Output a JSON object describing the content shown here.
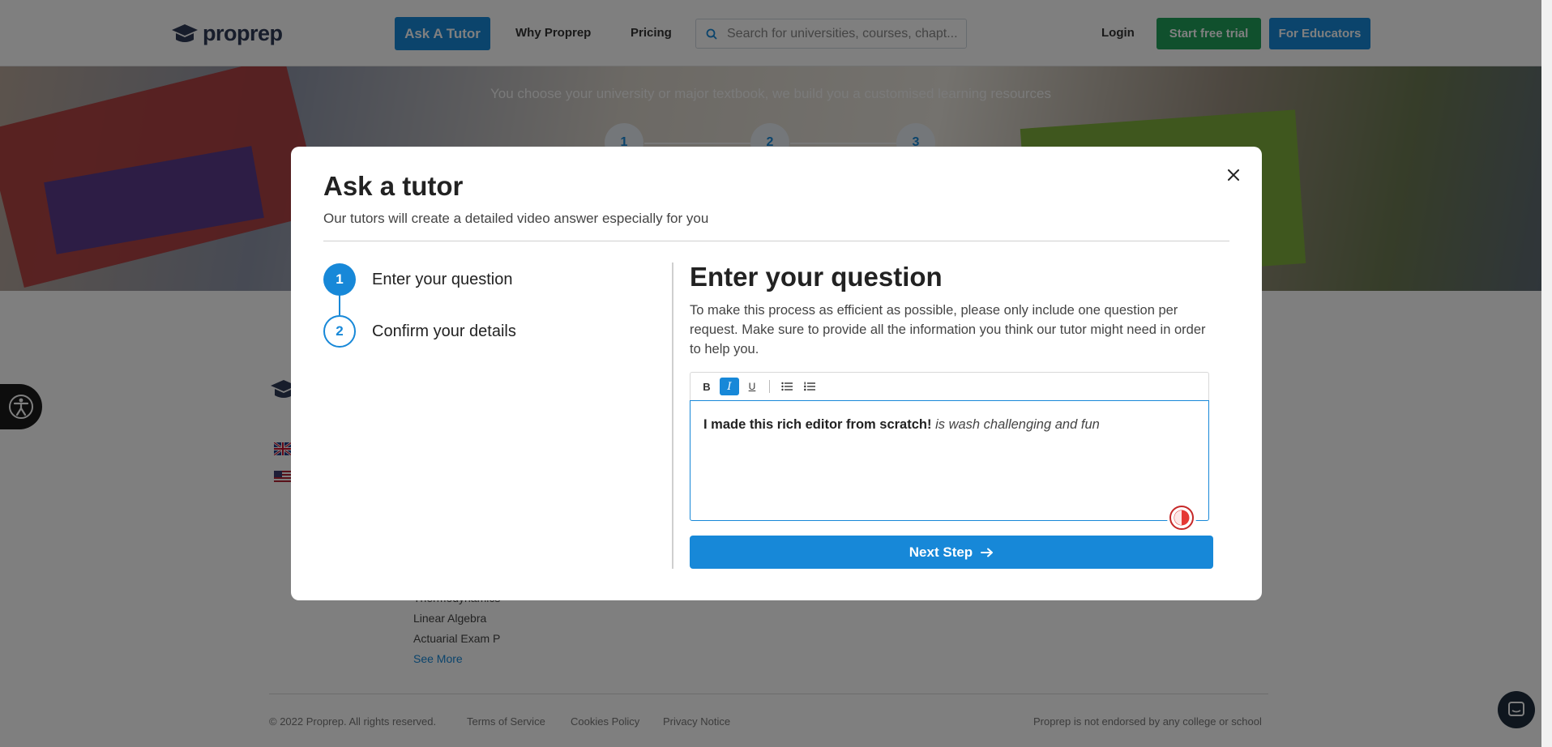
{
  "brand": {
    "logo_text": "proprep",
    "accent": "#1788d8",
    "success": "#21a05a"
  },
  "nav": {
    "ask_tutor": "Ask A Tutor",
    "why_proprep": "Why Proprep",
    "pricing": "Pricing",
    "search_placeholder": "Search for universities, courses, chapt...",
    "login": "Login",
    "start_trial": "Start free trial",
    "for_educators": "For Educators"
  },
  "hero": {
    "subtitle": "You choose your university or major textbook, we build you a customised learning resources",
    "steps": [
      "1",
      "2",
      "3"
    ]
  },
  "footer": {
    "links": [
      "Thermodynamics",
      "Linear Algebra",
      "Actuarial Exam P"
    ],
    "see_more": "See More",
    "copyright": "© 2022 Proprep. All rights reserved.",
    "terms": "Terms of Service",
    "cookies": "Cookies Policy",
    "privacy": "Privacy Notice",
    "disclaimer": "Proprep is not endorsed by any college or school"
  },
  "modal": {
    "title": "Ask a tutor",
    "subtitle": "Our tutors will create a detailed video answer especially for you",
    "steps": [
      {
        "number": "1",
        "label": "Enter your question"
      },
      {
        "number": "2",
        "label": "Confirm your details"
      }
    ],
    "content_title": "Enter your question",
    "content_description": "To make this process as efficient as possible, please only include one question per request. Make sure to provide all the information you think our tutor might need in order to help you.",
    "toolbar": {
      "bold": "B",
      "italic": "I",
      "underline": "U"
    },
    "editor": {
      "bold_text": "I made this rich editor from scratch!",
      "italic_text": "is wash challenging and fun"
    },
    "next_button": "Next Step"
  }
}
